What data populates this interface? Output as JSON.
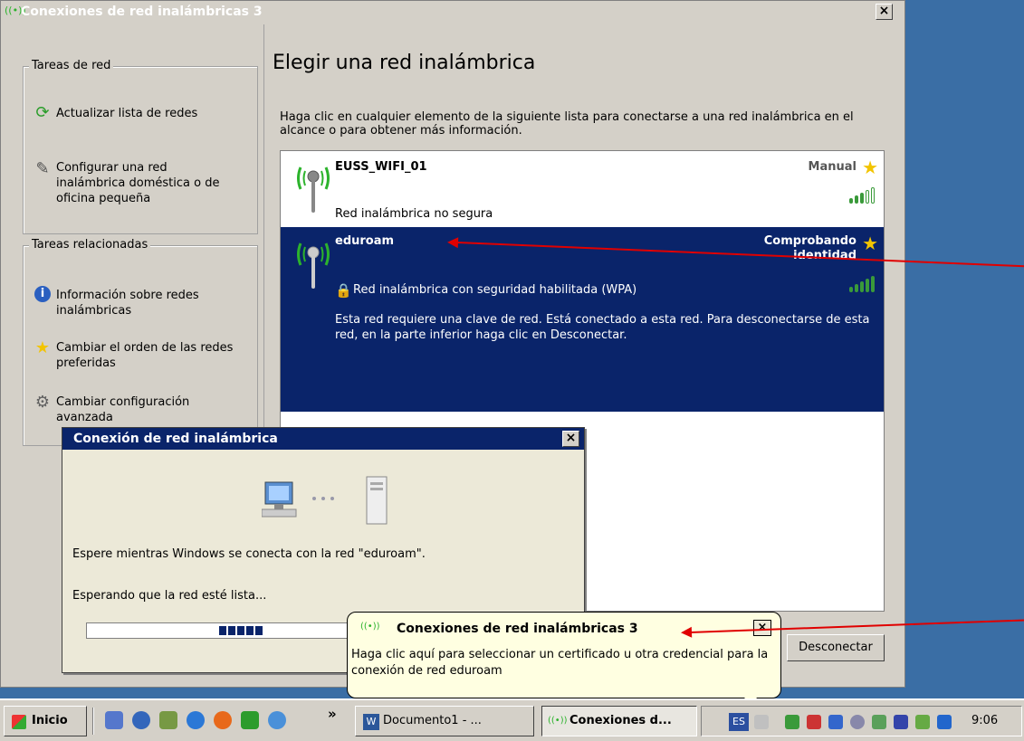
{
  "main_window": {
    "title": "Conexiones de red inalámbricas 3",
    "close_label": "×"
  },
  "sidebar": {
    "network_tasks": {
      "legend": "Tareas de red",
      "items": [
        {
          "label": "Actualizar lista de redes",
          "icon": "refresh-icon"
        },
        {
          "label": "Configurar una red inalámbrica doméstica o de oficina pequeña",
          "icon": "wizard-icon"
        }
      ]
    },
    "related_tasks": {
      "legend": "Tareas relacionadas",
      "items": [
        {
          "label": "Información sobre redes inalámbricas",
          "icon": "info-icon"
        },
        {
          "label": "Cambiar el orden de las redes preferidas",
          "icon": "star-icon"
        },
        {
          "label": "Cambiar configuración avanzada",
          "icon": "tools-icon"
        }
      ]
    }
  },
  "content": {
    "title": "Elegir una red inalámbrica",
    "description": "Haga clic en cualquier elemento de la siguiente lista para conectarse a una red inalámbrica en el alcance o para obtener más información.",
    "networks": [
      {
        "name": "EUSS_WIFI_01",
        "status": "Manual",
        "security": "Red inalámbrica no segura",
        "signal_bars": 3,
        "signal_max": 5,
        "selected": false
      },
      {
        "name": "eduroam",
        "status": "Comprobando identidad",
        "security": "Red inalámbrica con seguridad habilitada (WPA)",
        "description": "Esta red requiere una clave de red. Está conectado a esta red. Para desconectarse de esta red, en la parte inferior haga clic en Desconectar.",
        "signal_bars": 5,
        "signal_max": 5,
        "selected": true
      }
    ],
    "disconnect_button": "Desconectar"
  },
  "connection_dialog": {
    "title": "Conexión de red inalámbrica",
    "close_label": "×",
    "message": "Espere mientras Windows se conecta con la red \"eduroam\".",
    "status": "Esperando que la red esté lista...",
    "progress_blocks": 5
  },
  "balloon": {
    "title": "Conexiones de red inalámbricas 3",
    "body": "Haga clic aquí para seleccionar un certificado u otra credencial para la conexión de red eduroam",
    "close_label": "×"
  },
  "taskbar": {
    "start_label": "Inicio",
    "quick_launch_overflow": "»",
    "buttons": [
      {
        "label": "Documento1 - ...",
        "icon": "word-icon",
        "active": false
      },
      {
        "label": "Conexiones d...",
        "icon": "wireless-icon",
        "active": true
      }
    ],
    "language": "ES",
    "clock": "9:06"
  },
  "colors": {
    "selection": "#0a246a",
    "window_face": "#d4d0c8",
    "desktop": "#3a6ea5",
    "balloon": "#ffffe1",
    "annotation_arrow": "#e00000"
  }
}
